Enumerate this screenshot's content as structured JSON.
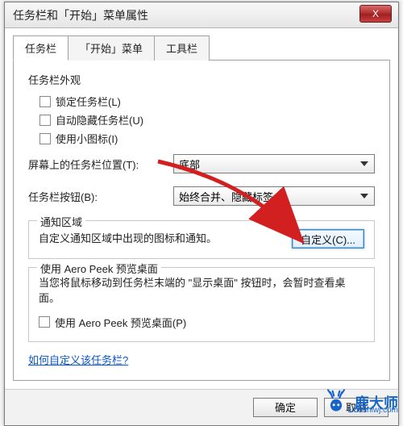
{
  "window": {
    "title": "任务栏和「开始」菜单属性",
    "close": "X"
  },
  "tabs": {
    "taskbar": "任务栏",
    "startmenu": "「开始」菜单",
    "toolbars": "工具栏"
  },
  "appearance": {
    "heading": "任务栏外观",
    "lock": "锁定任务栏(L)",
    "autohide": "自动隐藏任务栏(U)",
    "smallicons": "使用小图标(I)"
  },
  "position": {
    "label": "屏幕上的任务栏位置(T):",
    "value": "底部"
  },
  "buttons": {
    "label": "任务栏按钮(B):",
    "value": "始终合并、隐藏标签"
  },
  "notify": {
    "legend": "通知区域",
    "desc": "自定义通知区域中出现的图标和通知。",
    "customize": "自定义(C)..."
  },
  "aero": {
    "legend": "使用 Aero Peek 预览桌面",
    "desc": "当您将鼠标移动到任务栏末端的 \"显示桌面\" 按钮时，会暂时查看桌面。",
    "checkbox": "使用 Aero Peek 预览桌面(P)"
  },
  "link": "如何自定义该任务栏?",
  "footer": {
    "ok": "确定",
    "cancel": "取消"
  },
  "brand": {
    "name": "鹿大师",
    "url": "ludashiwj.com"
  }
}
